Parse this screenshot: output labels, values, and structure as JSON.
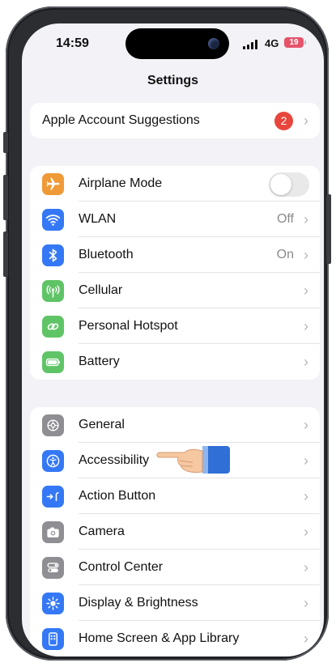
{
  "status_bar": {
    "time": "14:59",
    "network": "4G",
    "battery": "19"
  },
  "nav": {
    "title": "Settings"
  },
  "account": {
    "label": "Apple Account Suggestions",
    "badge": "2"
  },
  "connectivity": {
    "items": [
      {
        "label": "Airplane Mode",
        "icon": "airplane-icon",
        "color": "#f09a37",
        "toggle_on": false
      },
      {
        "label": "WLAN",
        "icon": "wifi-icon",
        "color": "#3478f6",
        "value": "Off"
      },
      {
        "label": "Bluetooth",
        "icon": "bluetooth-icon",
        "color": "#3478f6",
        "value": "On"
      },
      {
        "label": "Cellular",
        "icon": "cellular-icon",
        "color": "#5fc466"
      },
      {
        "label": "Personal Hotspot",
        "icon": "hotspot-icon",
        "color": "#5fc466"
      },
      {
        "label": "Battery",
        "icon": "battery-icon",
        "color": "#5fc466"
      }
    ]
  },
  "system": {
    "items": [
      {
        "label": "General",
        "icon": "gear-icon",
        "color": "#8e8e93"
      },
      {
        "label": "Accessibility",
        "icon": "accessibility-icon",
        "color": "#3478f6"
      },
      {
        "label": "Action Button",
        "icon": "action-button-icon",
        "color": "#3478f6"
      },
      {
        "label": "Camera",
        "icon": "camera-icon",
        "color": "#8e8e93"
      },
      {
        "label": "Control Center",
        "icon": "control-center-icon",
        "color": "#8e8e93"
      },
      {
        "label": "Display & Brightness",
        "icon": "sun-icon",
        "color": "#3478f6"
      },
      {
        "label": "Home Screen & App Library",
        "icon": "home-screen-icon",
        "color": "#3478f6"
      }
    ]
  },
  "overlay": {
    "pointer": "pointing-hand-icon"
  }
}
